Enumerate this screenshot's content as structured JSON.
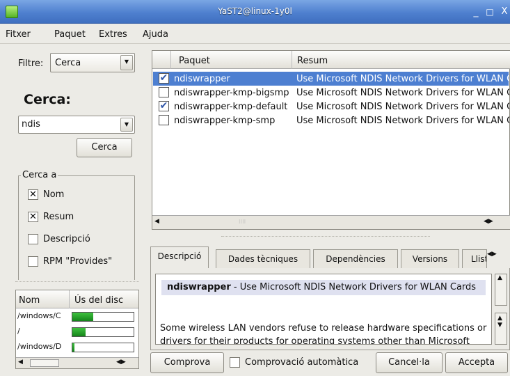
{
  "window": {
    "title": "YaST2@linux-1y0l",
    "minimize": "_",
    "maximize": "□",
    "close": "X"
  },
  "menu": [
    "Fitxer",
    "Paquet",
    "Extres",
    "Ajuda"
  ],
  "filter": {
    "label": "Filtre:",
    "value": "Cerca"
  },
  "search": {
    "heading": "Cerca:",
    "value": "ndis",
    "button": "Cerca",
    "in_label": "Cerca a",
    "options": [
      {
        "label": "Nom",
        "checked": true
      },
      {
        "label": "Resum",
        "checked": true
      },
      {
        "label": "Descripció",
        "checked": false
      },
      {
        "label": "RPM \"Provides\"",
        "checked": false
      }
    ]
  },
  "disk": {
    "headers": [
      "Nom",
      "Ús del disc"
    ],
    "rows": [
      {
        "name": "/windows/C",
        "usage": 0.34
      },
      {
        "name": "/",
        "usage": 0.22
      },
      {
        "name": "/windows/D",
        "usage": 0.03
      }
    ]
  },
  "packages": {
    "headers": [
      "Paquet",
      "Resum"
    ],
    "rows": [
      {
        "name": "ndiswrapper",
        "summary": "Use Microsoft NDIS Network Drivers for WLAN Cards",
        "checked": true,
        "selected": true
      },
      {
        "name": "ndiswrapper-kmp-bigsmp",
        "summary": "Use Microsoft NDIS Network Drivers for WLAN Cards",
        "checked": false,
        "selected": false
      },
      {
        "name": "ndiswrapper-kmp-default",
        "summary": "Use Microsoft NDIS Network Drivers for WLAN Cards",
        "checked": true,
        "selected": false
      },
      {
        "name": "ndiswrapper-kmp-smp",
        "summary": "Use Microsoft NDIS Network Drivers for WLAN Cards",
        "checked": false,
        "selected": false
      }
    ]
  },
  "tabs": [
    "Descripció",
    "Dades tècniques",
    "Dependències",
    "Versions",
    "Llista"
  ],
  "description": {
    "name": "ndiswrapper",
    "summary": " - Use Microsoft NDIS Network Drivers for WLAN Cards",
    "body": "Some wireless LAN vendors refuse to release hardware specifications or drivers for their products for operating systems other than Microsoft"
  },
  "bottom": {
    "check": "Comprova",
    "auto": "Comprovació automàtica",
    "cancel": "Cancel·la",
    "accept": "Accepta"
  },
  "colors": {
    "selection": "#4d7fd1",
    "titlebar": "#4f80cf"
  }
}
